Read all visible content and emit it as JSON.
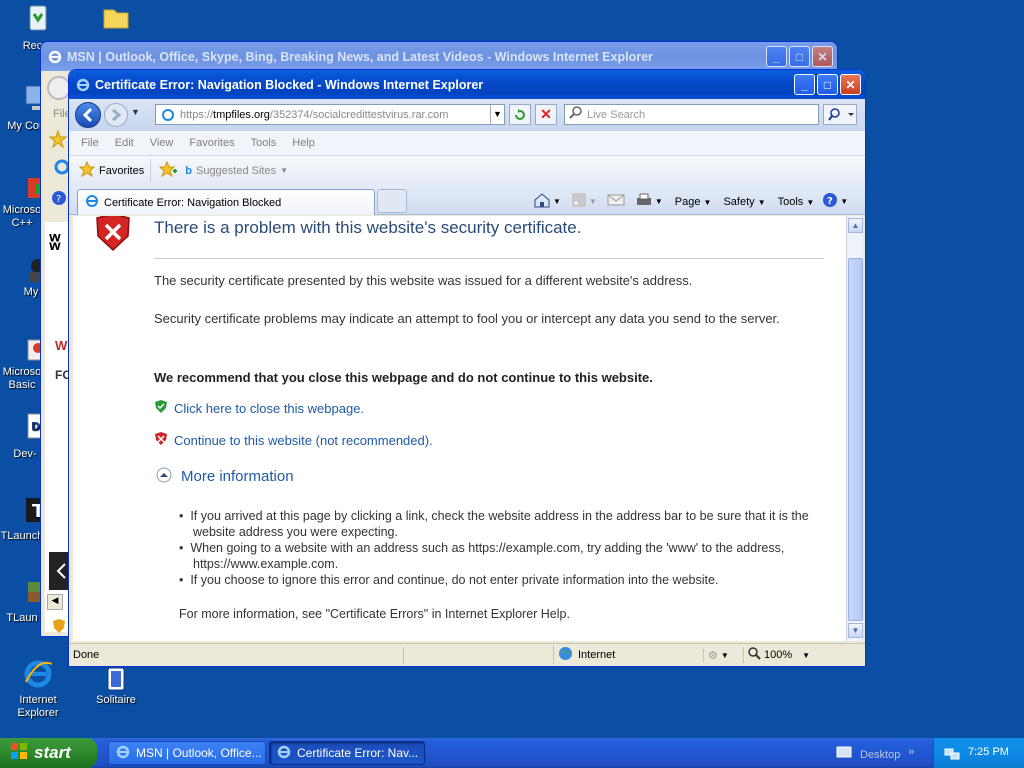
{
  "desktop": {
    "icons": [
      {
        "label": "Recyc",
        "icon": "recycle-bin-icon"
      },
      {
        "label": "",
        "icon": "folder-icon"
      },
      {
        "label": "My Cor",
        "icon": "my-computer-icon"
      },
      {
        "label": "Microso C++",
        "icon": "visual-cpp-icon"
      },
      {
        "label": "My",
        "icon": "user-icon"
      },
      {
        "label": "Microso Basic",
        "icon": "visual-basic-icon"
      },
      {
        "label": "Dev-",
        "icon": "devcpp-icon"
      },
      {
        "label": "TLaunch",
        "icon": "tlauncher-icon"
      },
      {
        "label": "TLaun",
        "icon": "tlauncher-icon"
      },
      {
        "label": "Internet Explorer",
        "icon": "internet-explorer-icon"
      },
      {
        "label": "Solitaire",
        "icon": "solitaire-icon"
      }
    ]
  },
  "back_window": {
    "title": "MSN | Outlook, Office, Skype, Bing, Breaking News, and Latest Videos - Windows Internet Explorer",
    "menu_fragment": "File",
    "red_text": "W",
    "dark_text": "FO"
  },
  "window": {
    "title": "Certificate Error: Navigation Blocked - Windows Internet Explorer",
    "address": {
      "prefix": "https://",
      "host": "tmpfiles.org",
      "path": "/352374/socialcredittestvirus.rar.com"
    },
    "search_placeholder": "Live Search",
    "menu": [
      "File",
      "Edit",
      "View",
      "Favorites",
      "Tools",
      "Help"
    ],
    "favorites_label": "Favorites",
    "suggested_sites": "Suggested Sites",
    "tab_label": "Certificate Error: Navigation Blocked",
    "command_bar": {
      "page": "Page",
      "safety": "Safety",
      "tools": "Tools"
    },
    "status": {
      "text": "Done",
      "zone": "Internet",
      "zoom": "100%"
    }
  },
  "page": {
    "heading": "There is a problem with this website's security certificate.",
    "p1": "The security certificate presented by this website was issued for a different website's address.",
    "p2": "Security certificate problems may indicate an attempt to fool you or intercept any data you send to the server.",
    "recommend": "We recommend that you close this webpage and do not continue to this website.",
    "close_link": "Click here to close this webpage.",
    "continue_link": "Continue to this website (not recommended).",
    "more_info": "More information",
    "bullets": [
      "If you arrived at this page by clicking a link, check the website address in the address bar to be sure that it is the website address you were expecting.",
      "When going to a website with an address such as https://example.com, try adding the 'www' to the address, https://www.example.com.",
      "If you choose to ignore this error and continue, do not enter private information into the website."
    ],
    "footer": "For more information, see \"Certificate Errors\" in Internet Explorer Help."
  },
  "taskbar": {
    "start": "start",
    "tasks": [
      "MSN | Outlook, Office...",
      "Certificate Error: Nav..."
    ],
    "desktop_label": "Desktop",
    "clock": "7:25 PM"
  }
}
